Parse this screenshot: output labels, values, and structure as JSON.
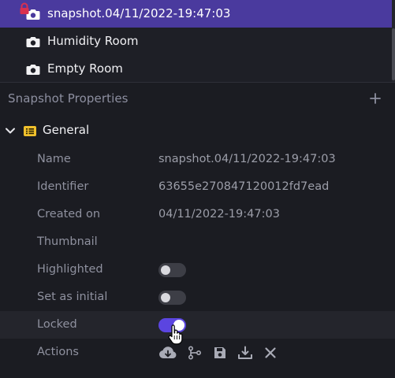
{
  "snapshots": {
    "items": [
      {
        "label": "snapshot.04/11/2022-19:47:03",
        "icon": "camera-icon",
        "locked": true,
        "selected": true
      },
      {
        "label": "Humidity Room",
        "icon": "camera-icon",
        "selected": false
      },
      {
        "label": "Empty Room",
        "icon": "camera-icon",
        "selected": false
      }
    ]
  },
  "properties": {
    "title": "Snapshot Properties",
    "add_icon": "plus-icon",
    "section": {
      "title": "General",
      "expanded": true,
      "icon": "list-icon"
    },
    "fields": {
      "name": {
        "key": "Name",
        "value": "snapshot.04/11/2022-19:47:03"
      },
      "identifier": {
        "key": "Identifier",
        "value": "63655e270847120012fd7ead"
      },
      "created_on": {
        "key": "Created on",
        "value": "04/11/2022-19:47:03"
      },
      "thumbnail": {
        "key": "Thumbnail"
      },
      "highlighted": {
        "key": "Highlighted",
        "on": false
      },
      "set_as_initial": {
        "key": "Set as initial",
        "on": false
      },
      "locked": {
        "key": "Locked",
        "on": true
      },
      "actions": {
        "key": "Actions",
        "icons": [
          "cloud-download-icon",
          "branch-icon",
          "save-icon",
          "download-icon",
          "close-icon"
        ]
      }
    }
  },
  "colors": {
    "selected_row": "#4a3a9e",
    "toggle_on": "#5b45e0",
    "general_icon": "#f0c02c",
    "lock_badge": "#d9304f"
  }
}
